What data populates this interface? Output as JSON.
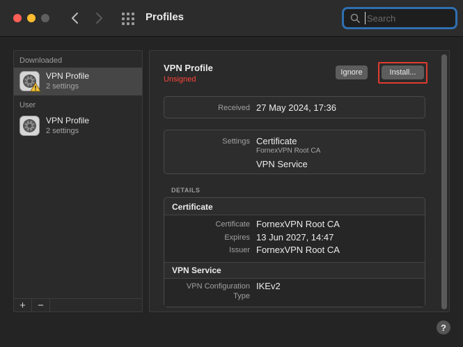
{
  "window": {
    "title": "Profiles"
  },
  "search": {
    "placeholder": "Search",
    "value": ""
  },
  "sidebar": {
    "sections": [
      {
        "label": "Downloaded",
        "items": [
          {
            "name": "VPN Profile",
            "subtitle": "2 settings",
            "warning": true,
            "selected": true
          }
        ]
      },
      {
        "label": "User",
        "items": [
          {
            "name": "VPN Profile",
            "subtitle": "2 settings",
            "warning": false,
            "selected": false
          }
        ]
      }
    ],
    "add_label": "+",
    "remove_label": "−"
  },
  "profile": {
    "title": "VPN Profile",
    "status": "Unsigned",
    "ignore_label": "Ignore",
    "install_label": "Install...",
    "received_key": "Received",
    "received_value": "27 May 2024, 17:36",
    "settings_key": "Settings",
    "settings": [
      {
        "title": "Certificate",
        "subtitle": "FornexVPN Root CA"
      },
      {
        "title": "VPN Service",
        "subtitle": ""
      }
    ]
  },
  "details": {
    "label": "DETAILS",
    "certificate": {
      "heading": "Certificate",
      "rows": [
        {
          "key": "Certificate",
          "value": "FornexVPN Root CA"
        },
        {
          "key": "Expires",
          "value": "13 Jun 2027, 14:47"
        },
        {
          "key": "Issuer",
          "value": "FornexVPN Root CA"
        }
      ]
    },
    "vpn_service": {
      "heading": "VPN Service",
      "rows": [
        {
          "key": "VPN Configuration",
          "key2": "Type",
          "value": "IKEv2"
        }
      ]
    }
  },
  "help": {
    "label": "?"
  },
  "colors": {
    "accent": "#2f6fb0",
    "unsigned": "#ff453a",
    "highlight": "#e03b30"
  }
}
